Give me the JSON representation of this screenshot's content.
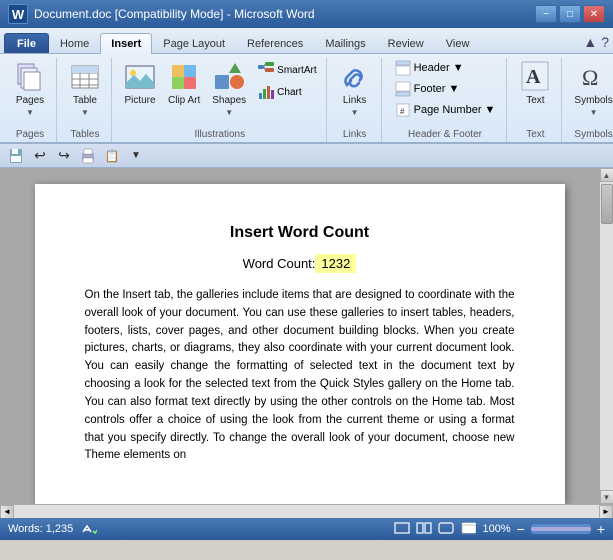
{
  "titlebar": {
    "title": "Document.doc [Compatibility Mode] - Microsoft Word",
    "word_letter": "W",
    "controls": {
      "minimize": "−",
      "restore": "□",
      "close": "✕"
    }
  },
  "tabs": [
    {
      "label": "File",
      "active": false,
      "is_file": true
    },
    {
      "label": "Home",
      "active": false,
      "is_file": false
    },
    {
      "label": "Insert",
      "active": true,
      "is_file": false
    },
    {
      "label": "Page Layout",
      "active": false,
      "is_file": false
    },
    {
      "label": "References",
      "active": false,
      "is_file": false
    },
    {
      "label": "Mailings",
      "active": false,
      "is_file": false
    },
    {
      "label": "Review",
      "active": false,
      "is_file": false
    },
    {
      "label": "View",
      "active": false,
      "is_file": false
    }
  ],
  "ribbon": {
    "groups": [
      {
        "name": "Pages",
        "label": "Pages"
      },
      {
        "name": "Tables",
        "label": "Tables"
      },
      {
        "name": "Illustrations",
        "label": "Illustrations",
        "buttons": [
          "Picture",
          "Clip Art",
          "Shapes"
        ]
      },
      {
        "name": "Links",
        "label": "Links"
      },
      {
        "name": "HeaderFooter",
        "label": "Header & Footer",
        "items": [
          "Header",
          "Footer",
          "Page Number"
        ]
      },
      {
        "name": "Text",
        "label": "Text",
        "button_label": "Text"
      },
      {
        "name": "Symbols",
        "label": "Symbols",
        "button_label": "Symbols"
      }
    ]
  },
  "document": {
    "title": "Insert Word Count",
    "word_count_label": "Word Count:",
    "word_count_value": "1232",
    "body_text": "On the Insert tab, the galleries include items that are designed to coordinate with the overall look of your document. You can use these galleries to insert tables, headers, footers, lists, cover pages, and other document building blocks. When you create pictures, charts, or diagrams, they also coordinate with your current document look. You can easily change the formatting of selected text in the document text by choosing a look for the selected text from the Quick Styles gallery on the Home tab. You can also format text directly by using the other controls on the Home tab. Most controls offer a choice of using the look from the current theme or using a format that you specify directly. To change the overall look of your document, choose new Theme elements on"
  },
  "statusbar": {
    "words_label": "Words: 1,235",
    "zoom_value": "100%",
    "zoom_minus": "−",
    "zoom_plus": "+"
  },
  "quick_access": {
    "buttons": [
      "💾",
      "↩",
      "↪",
      "🖨",
      "📋",
      "▼"
    ]
  }
}
